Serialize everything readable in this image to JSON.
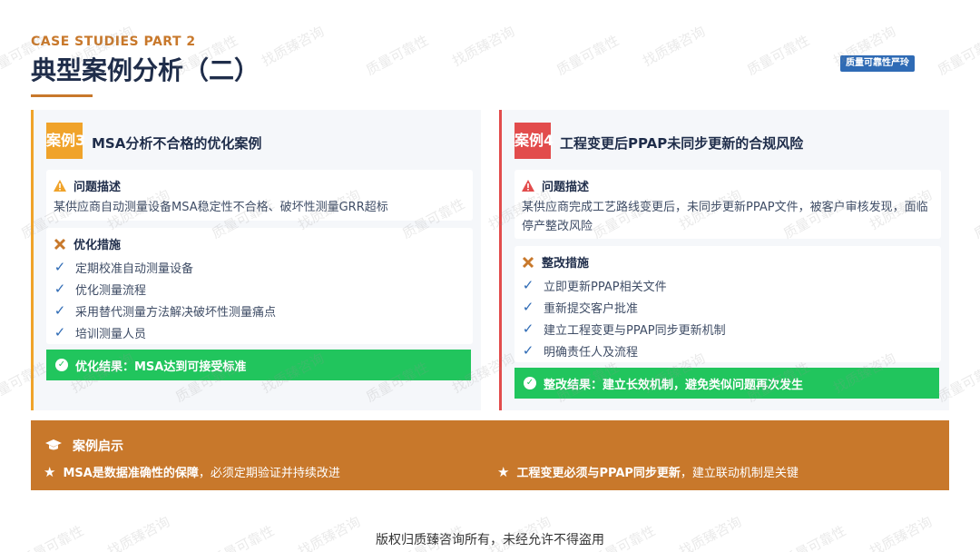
{
  "header": {
    "eyebrow": "CASE STUDIES PART 2",
    "title": "典型案例分析（二）",
    "brand_badge": "质量可靠性严玲"
  },
  "watermark": {
    "texts": [
      "质量可靠性",
      "找质臻咨询"
    ]
  },
  "cases": [
    {
      "tag": "案例3",
      "title": "MSA分析不合格的优化案例",
      "problem_label": "问题描述",
      "problem_text": "某供应商自动测量设备MSA稳定性不合格、破坏性测量GRR超标",
      "measures_label": "优化措施",
      "measures": [
        "定期校准自动测量设备",
        "优化测量流程",
        "采用替代测量方法解决破坏性测量痛点",
        "培训测量人员"
      ],
      "result": "优化结果：MSA达到可接受标准"
    },
    {
      "tag": "案例4",
      "title": "工程变更后PPAP未同步更新的合规风险",
      "problem_label": "问题描述",
      "problem_text": "某供应商完成工艺路线变更后，未同步更新PPAP文件，被客户审核发现，面临停产整改风险",
      "measures_label": "整改措施",
      "measures": [
        "立即更新PPAP相关文件",
        "重新提交客户批准",
        "建立工程变更与PPAP同步更新机制",
        "明确责任人及流程"
      ],
      "result": "整改结果：建立长效机制，避免类似问题再次发生"
    }
  ],
  "insights": {
    "label": "案例启示",
    "items": [
      {
        "bold": "MSA是数据准确性的保障",
        "rest": "，必须定期验证并持续改进"
      },
      {
        "bold": "工程变更必须与PPAP同步更新",
        "rest": "，建立联动机制是关键"
      }
    ]
  },
  "footer": "版权归质臻咨询所有，未经允许不得盗用",
  "colors": {
    "accent_orange": "#c8782b",
    "case3": "#f0a32a",
    "case4": "#e24c4c",
    "success": "#21c55d",
    "navy": "#1f2d4a",
    "blue": "#2f6bb5"
  },
  "icons": {
    "problem": "warning-triangle-icon",
    "measures": "tools-icon",
    "measure_item": "check-icon",
    "result": "check-circle-icon",
    "insight": "graduation-cap-icon",
    "insight_item": "star-icon"
  }
}
